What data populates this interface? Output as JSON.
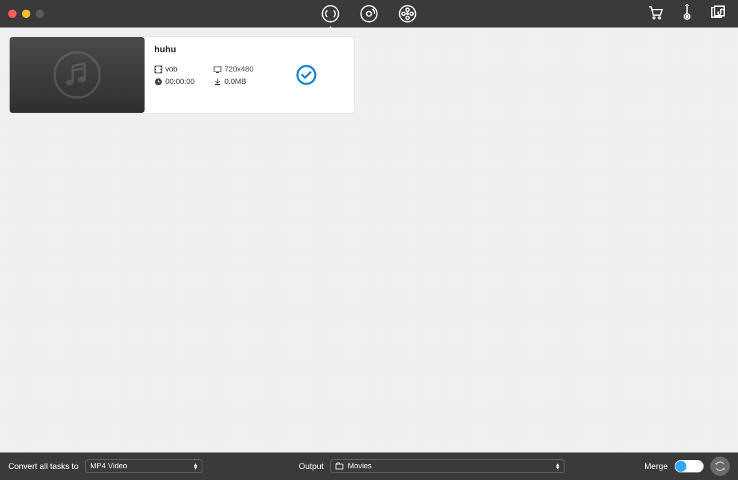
{
  "titlebar": {
    "modes": [
      "convert",
      "dvd",
      "download"
    ]
  },
  "task": {
    "title": "huhu",
    "container": "vob",
    "resolution": "720x480",
    "duration": "00:00:00",
    "filesize": "0.0MB"
  },
  "footer": {
    "convert_label": "Convert all tasks to",
    "format_value": "MP4 Video",
    "output_label": "Output",
    "output_value": "Movies",
    "merge_label": "Merge"
  },
  "colors": {
    "accent": "#1383d2"
  }
}
